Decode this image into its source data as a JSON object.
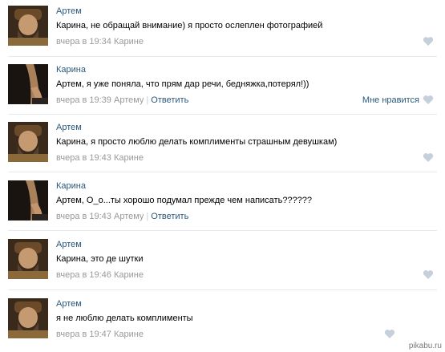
{
  "comments": [
    {
      "author": "Артем",
      "text": "Карина, не обращай внимание) я просто ослеплен фотографией",
      "time": "вчера в 19:34",
      "reply_to": "Карине"
    },
    {
      "author": "Карина",
      "text": "Артем, я уже поняла, что прям дар речи, бедняжка,потерял!))",
      "time": "вчера в 19:39",
      "reply_to": "Артему",
      "reply_label": "Ответить",
      "like_label": "Мне нравится"
    },
    {
      "author": "Артем",
      "text": "Карина, я просто люблю делать комплименты страшным девушкам)",
      "time": "вчера в 19:43",
      "reply_to": "Карине"
    },
    {
      "author": "Карина",
      "text": "Артем, О_о...ты хорошо подумал прежде чем написать??????",
      "time": "вчера в 19:43",
      "reply_to": "Артему",
      "reply_label": "Ответить"
    },
    {
      "author": "Артем",
      "text": "Карина, это де шутки",
      "time": "вчера в 19:46",
      "reply_to": "Карине"
    },
    {
      "author": "Артем",
      "text": "я не люблю делать комплименты",
      "time": "вчера в 19:47",
      "reply_to": "Карине"
    }
  ],
  "watermark": "pikabu.ru",
  "colors": {
    "link": "#2b587a",
    "meta": "#999999",
    "divider": "#e7e8ec",
    "heart": "#c5d0db"
  }
}
